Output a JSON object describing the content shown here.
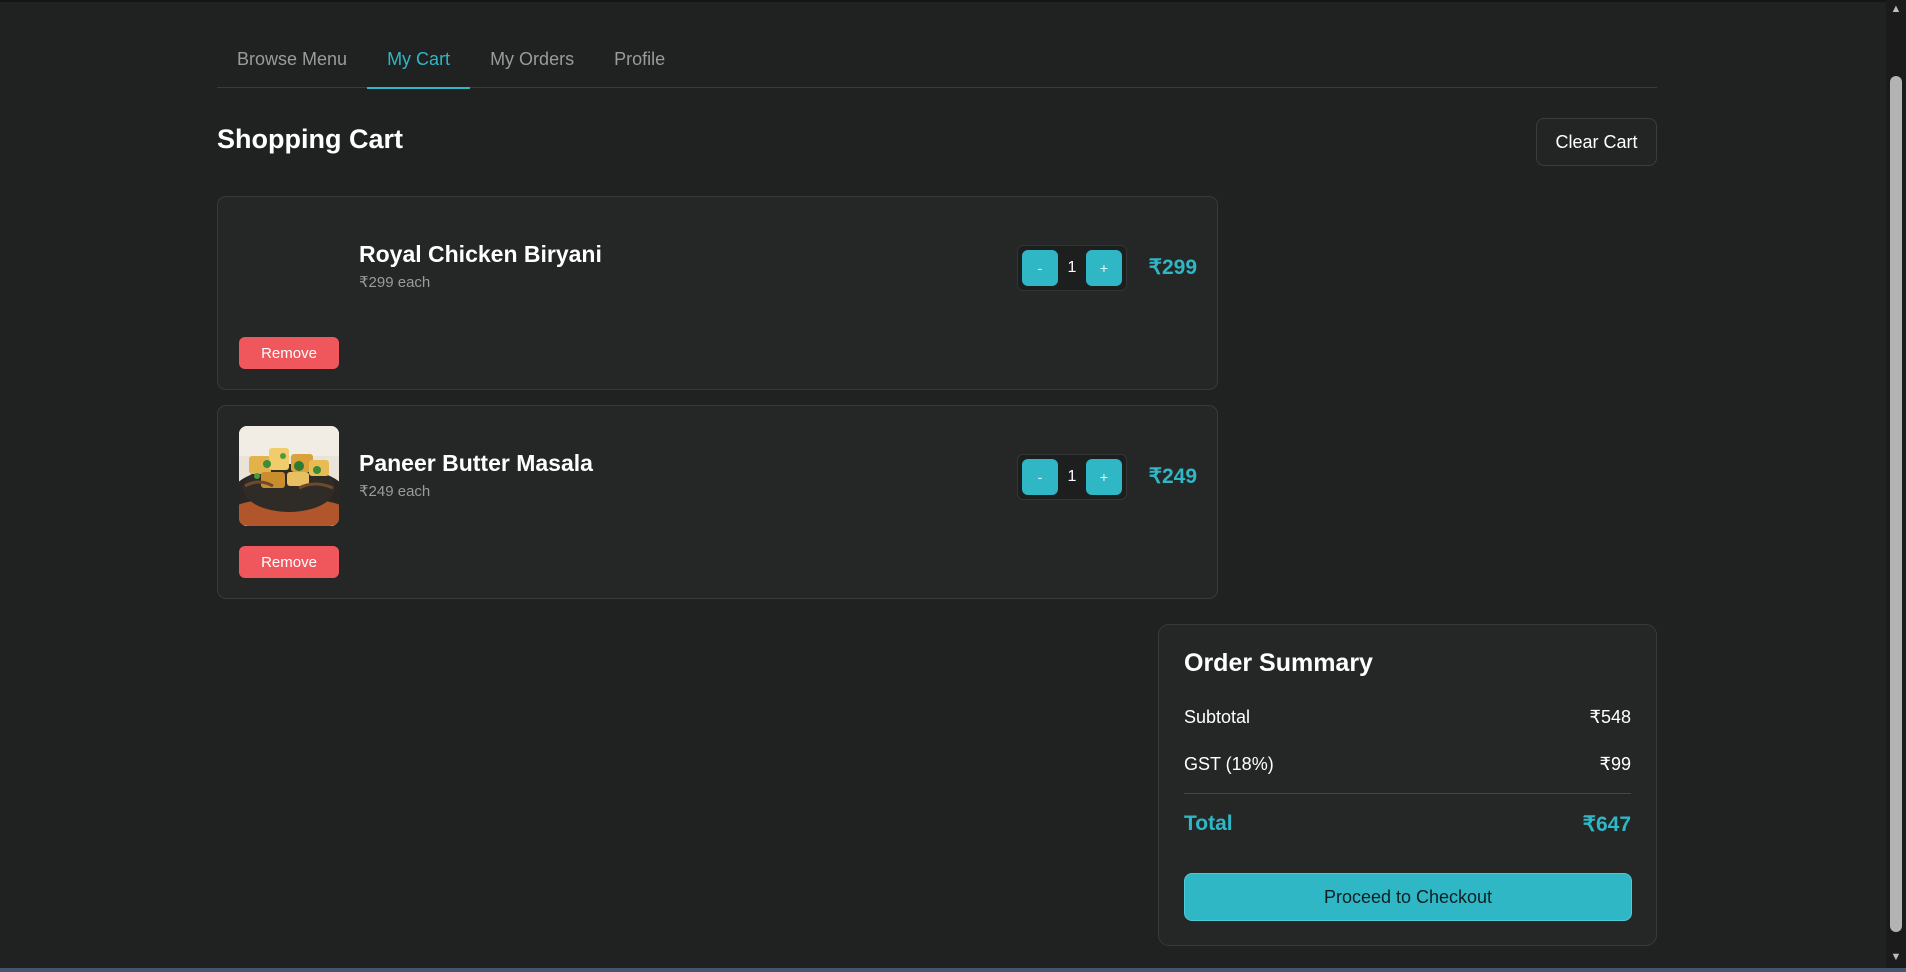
{
  "tabs": [
    {
      "label": "Browse Menu",
      "active": false
    },
    {
      "label": "My Cart",
      "active": true
    },
    {
      "label": "My Orders",
      "active": false
    },
    {
      "label": "Profile",
      "active": false
    }
  ],
  "page_title": "Shopping Cart",
  "clear_cart_label": "Clear Cart",
  "cart_items": [
    {
      "name": "Royal Chicken Biryani",
      "each": "₹299 each",
      "quantity": "1",
      "minus_label": "-",
      "plus_label": "+",
      "total": "₹299",
      "remove_label": "Remove",
      "image": "none"
    },
    {
      "name": "Paneer Butter Masala",
      "each": "₹249 each",
      "quantity": "1",
      "minus_label": "-",
      "plus_label": "+",
      "total": "₹249",
      "remove_label": "Remove",
      "image": "paneer-dish-photo"
    }
  ],
  "summary": {
    "title": "Order Summary",
    "subtotal_label": "Subtotal",
    "subtotal_value": "₹548",
    "gst_label": "GST (18%)",
    "gst_value": "₹99",
    "total_label": "Total",
    "total_value": "₹647",
    "checkout_label": "Proceed to Checkout"
  },
  "colors": {
    "background": "#202221",
    "card": "#252727",
    "accent": "#2fb7c6",
    "danger": "#f0575c",
    "muted_text": "#9a9c9c"
  }
}
